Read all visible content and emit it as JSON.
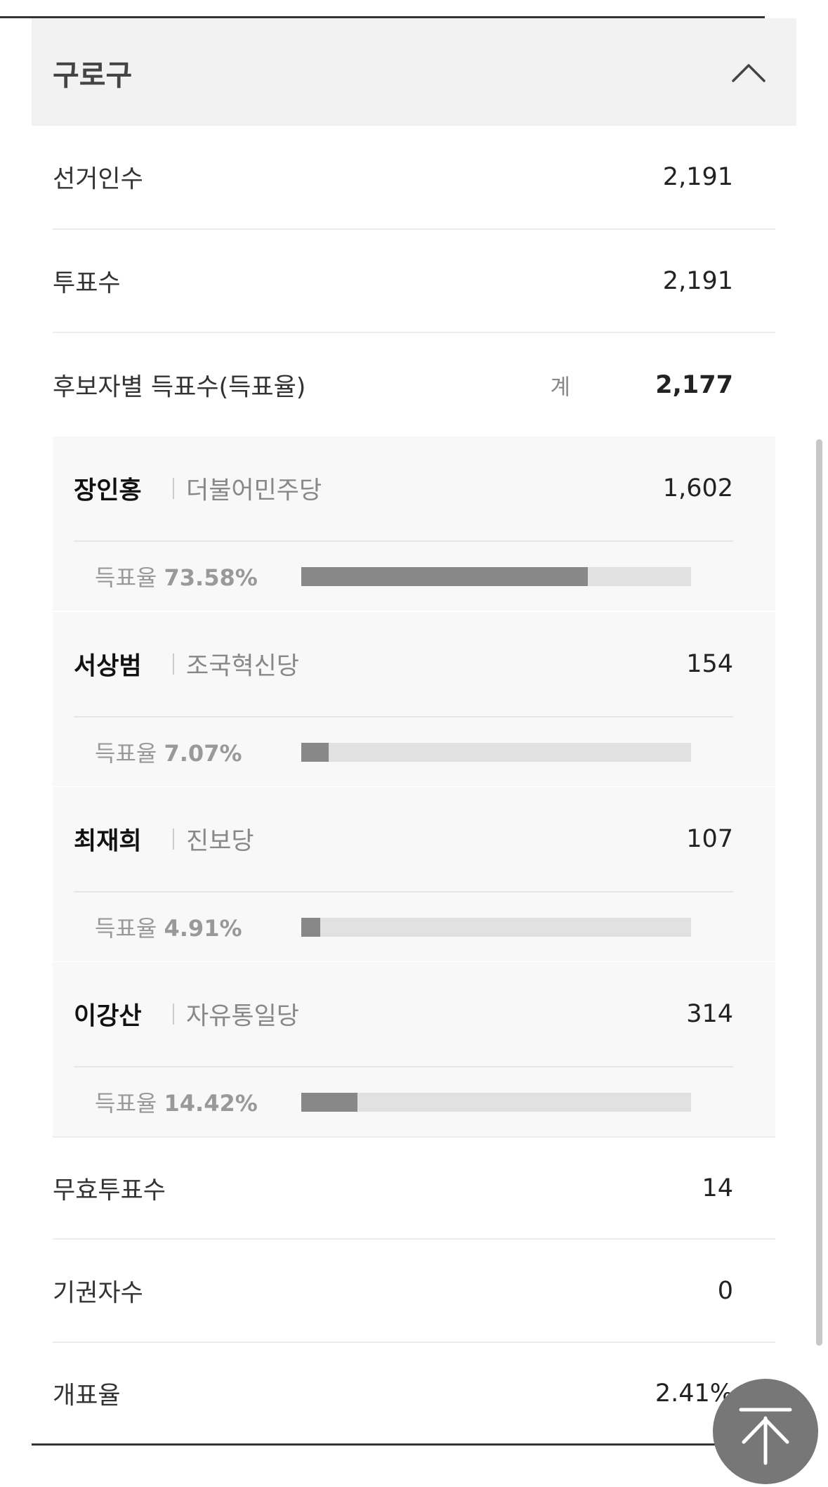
{
  "region": {
    "title": "구로구",
    "collapse_icon": "chevron-up-icon"
  },
  "stats": {
    "electorate": {
      "label": "선거인수",
      "value": "2,191"
    },
    "turnout": {
      "label": "투표수",
      "value": "2,191"
    },
    "candidate_votes": {
      "label": "후보자별 득표수(득표율)",
      "total_label": "계",
      "total_value": "2,177"
    }
  },
  "candidates": [
    {
      "name": "장인홍",
      "party": "더불어민주당",
      "votes": "1,602",
      "rate_label": "득표율",
      "rate_value": "73.58%",
      "rate": 73.58
    },
    {
      "name": "서상범",
      "party": "조국혁신당",
      "votes": "154",
      "rate_label": "득표율",
      "rate_value": "7.07%",
      "rate": 7.07
    },
    {
      "name": "최재희",
      "party": "진보당",
      "votes": "107",
      "rate_label": "득표율",
      "rate_value": "4.91%",
      "rate": 4.91
    },
    {
      "name": "이강산",
      "party": "자유통일당",
      "votes": "314",
      "rate_label": "득표율",
      "rate_value": "14.42%",
      "rate": 14.42
    }
  ],
  "summary": {
    "invalid": {
      "label": "무효투표수",
      "value": "14"
    },
    "abstain": {
      "label": "기권자수",
      "value": "0"
    },
    "counted": {
      "label": "개표율",
      "value": "2.41%"
    }
  },
  "colors": {
    "bar_fill": "#888888",
    "bar_track": "#e1e1e1",
    "header_bg": "#f2f2f2",
    "candidate_bg": "#f8f8f8"
  },
  "floating": {
    "icon": "arrow-up-icon"
  }
}
